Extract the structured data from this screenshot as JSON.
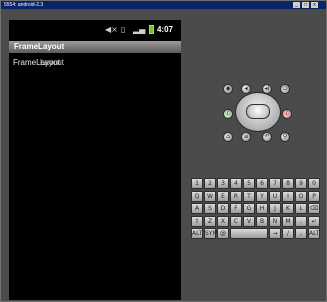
{
  "window": {
    "title": "5554: android-2.3"
  },
  "status_bar": {
    "time": "4:07",
    "icons": [
      "mute-icon",
      "sim-missing-icon",
      "signal-icon",
      "battery-icon"
    ]
  },
  "app": {
    "title": "FrameLayout",
    "text_a": "FrameLayout",
    "text_b": "Layout"
  },
  "keyboard": {
    "rows": [
      [
        "1",
        "2",
        "3",
        "4",
        "5",
        "6",
        "7",
        "8",
        "9",
        "0"
      ],
      [
        "Q",
        "W",
        "E",
        "R",
        "T",
        "Y",
        "U",
        "I",
        "O",
        "P"
      ],
      [
        "A",
        "S",
        "D",
        "F",
        "G",
        "H",
        "J",
        "K",
        "L",
        "⌫"
      ],
      [
        "⇧",
        "Z",
        "X",
        "C",
        "V",
        "B",
        "N",
        "M",
        ".",
        "↵"
      ],
      [
        "ALT",
        "SYM",
        "@",
        "",
        "→",
        "/",
        ",",
        "ALT"
      ]
    ]
  },
  "controls": {
    "top_row": [
      "camera-icon",
      "volume-down-icon",
      "volume-up-icon",
      "power-icon"
    ],
    "call": "call-icon",
    "end": "end-call-icon",
    "bottom_row": [
      "home-icon",
      "menu-icon",
      "back-icon",
      "search-icon"
    ]
  }
}
